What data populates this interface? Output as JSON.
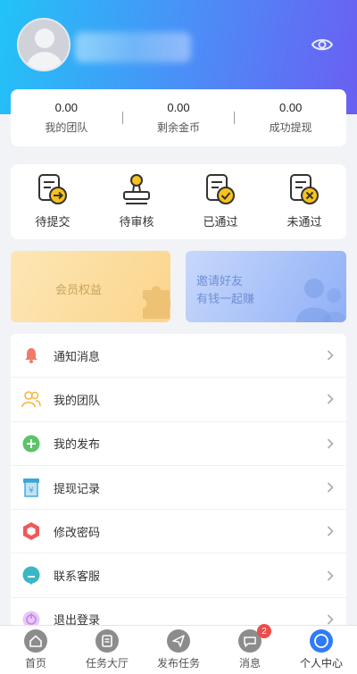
{
  "stats": [
    {
      "value": "0.00",
      "label": "我的团队"
    },
    {
      "value": "0.00",
      "label": "剩余金币"
    },
    {
      "value": "0.00",
      "label": "成功提现"
    }
  ],
  "task_status": [
    {
      "label": "待提交",
      "icon": "submit-pending-icon"
    },
    {
      "label": "待审核",
      "icon": "stamp-review-icon"
    },
    {
      "label": "已通过",
      "icon": "approved-icon"
    },
    {
      "label": "未通过",
      "icon": "rejected-icon"
    }
  ],
  "banners": {
    "member": {
      "text": "会员权益"
    },
    "invite": {
      "line1": "邀请好友",
      "line2": "有钱一起赚"
    }
  },
  "menu": [
    {
      "label": "通知消息",
      "icon": "bell-icon",
      "color": "#f07b6b"
    },
    {
      "label": "我的团队",
      "icon": "team-icon",
      "color": "#f2b540"
    },
    {
      "label": "我的发布",
      "icon": "plus-circle-icon",
      "color": "#5dc26a"
    },
    {
      "label": "提现记录",
      "icon": "receipt-icon",
      "color": "#3ca6d6"
    },
    {
      "label": "修改密码",
      "icon": "hexagon-lock-icon",
      "color": "#ef5a57"
    },
    {
      "label": "联系客服",
      "icon": "chat-icon",
      "color": "#3bb6c7"
    },
    {
      "label": "退出登录",
      "icon": "logout-icon",
      "color": "#c58ae8"
    }
  ],
  "tabs": [
    {
      "label": "首页",
      "icon": "home-icon"
    },
    {
      "label": "任务大厅",
      "icon": "task-hall-icon"
    },
    {
      "label": "发布任务",
      "icon": "send-icon"
    },
    {
      "label": "消息",
      "icon": "message-icon",
      "badge": "2"
    },
    {
      "label": "个人中心",
      "icon": "profile-icon",
      "active": true
    }
  ],
  "colors": {
    "header_start": "#22c3f7",
    "header_end": "#6a5ff2",
    "accent": "#2f7cf6",
    "badge": "#f04b4b"
  }
}
